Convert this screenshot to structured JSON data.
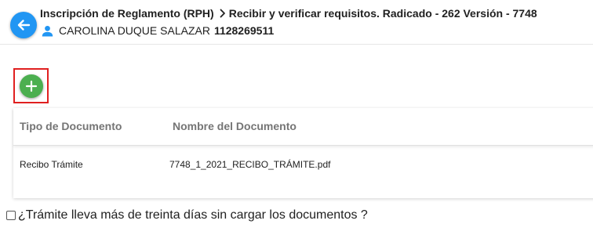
{
  "header": {
    "breadcrumb": {
      "parent": "Inscripción de Reglamento (RPH)",
      "current": "Recibir y verificar requisitos. Radicado - 262 Versión - 7748"
    },
    "person": {
      "name": "CAROLINA DUQUE SALAZAR",
      "id_number": "1128269511"
    }
  },
  "icons": {
    "back": "arrow-left-icon",
    "separator": "chevron-right-icon",
    "user": "user-icon",
    "add": "plus-icon"
  },
  "colors": {
    "back_button": "#2196f3",
    "add_button": "#4caf50",
    "highlight": "#e02020",
    "header_text": "#757575"
  },
  "documents_table": {
    "columns": [
      "Tipo de Documento",
      "Nombre del Documento"
    ],
    "rows": [
      {
        "tipo": "Recibo Trámite",
        "nombre": "7748_1_2021_RECIBO_TRÁMITE.pdf"
      }
    ]
  },
  "late_upload_question": {
    "label": "¿Trámite lleva más de treinta días sin cargar los documentos ?",
    "checked": false
  }
}
